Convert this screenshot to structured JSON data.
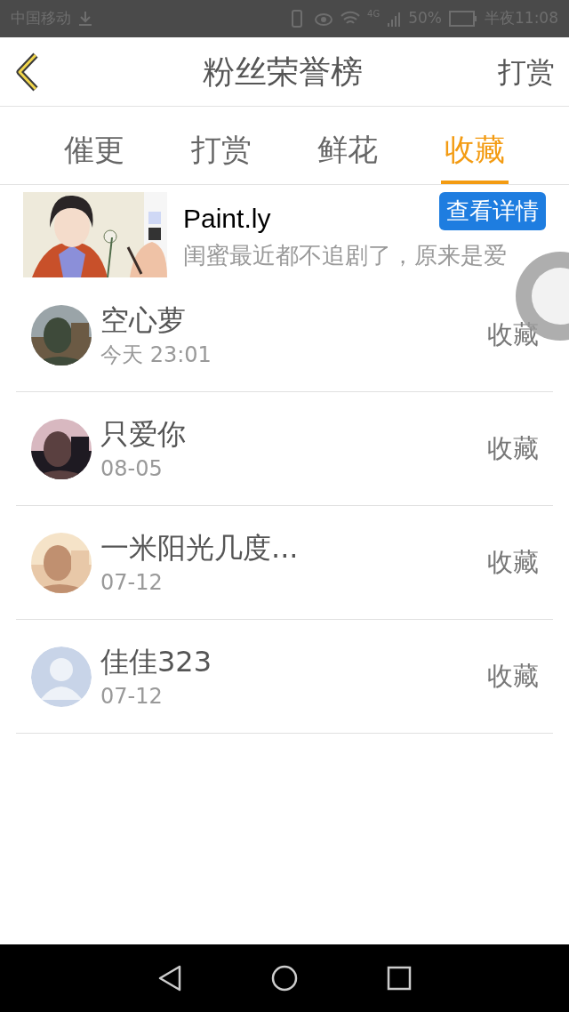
{
  "status_bar": {
    "carrier": "中国移动",
    "network": "4G",
    "battery": "50%",
    "time": "半夜11:08"
  },
  "header": {
    "title": "粉丝荣誉榜",
    "action": "打赏"
  },
  "tabs": [
    {
      "label": "催更",
      "selected": false
    },
    {
      "label": "打赏",
      "selected": false
    },
    {
      "label": "鲜花",
      "selected": false
    },
    {
      "label": "收藏",
      "selected": true
    }
  ],
  "ad": {
    "title": "Paint.ly",
    "button": "查看详情",
    "description": "闺蜜最近都不追剧了，原来是爱"
  },
  "fans": [
    {
      "name": "空心萝",
      "time": "今天 23:01",
      "action": "收藏"
    },
    {
      "name": "只爱你",
      "time": "08-05",
      "action": "收藏"
    },
    {
      "name": "一米阳光几度...",
      "time": "07-12",
      "action": "收藏"
    },
    {
      "kind": "default",
      "name": "佳佳323",
      "time": "07-12",
      "action": "收藏"
    }
  ]
}
